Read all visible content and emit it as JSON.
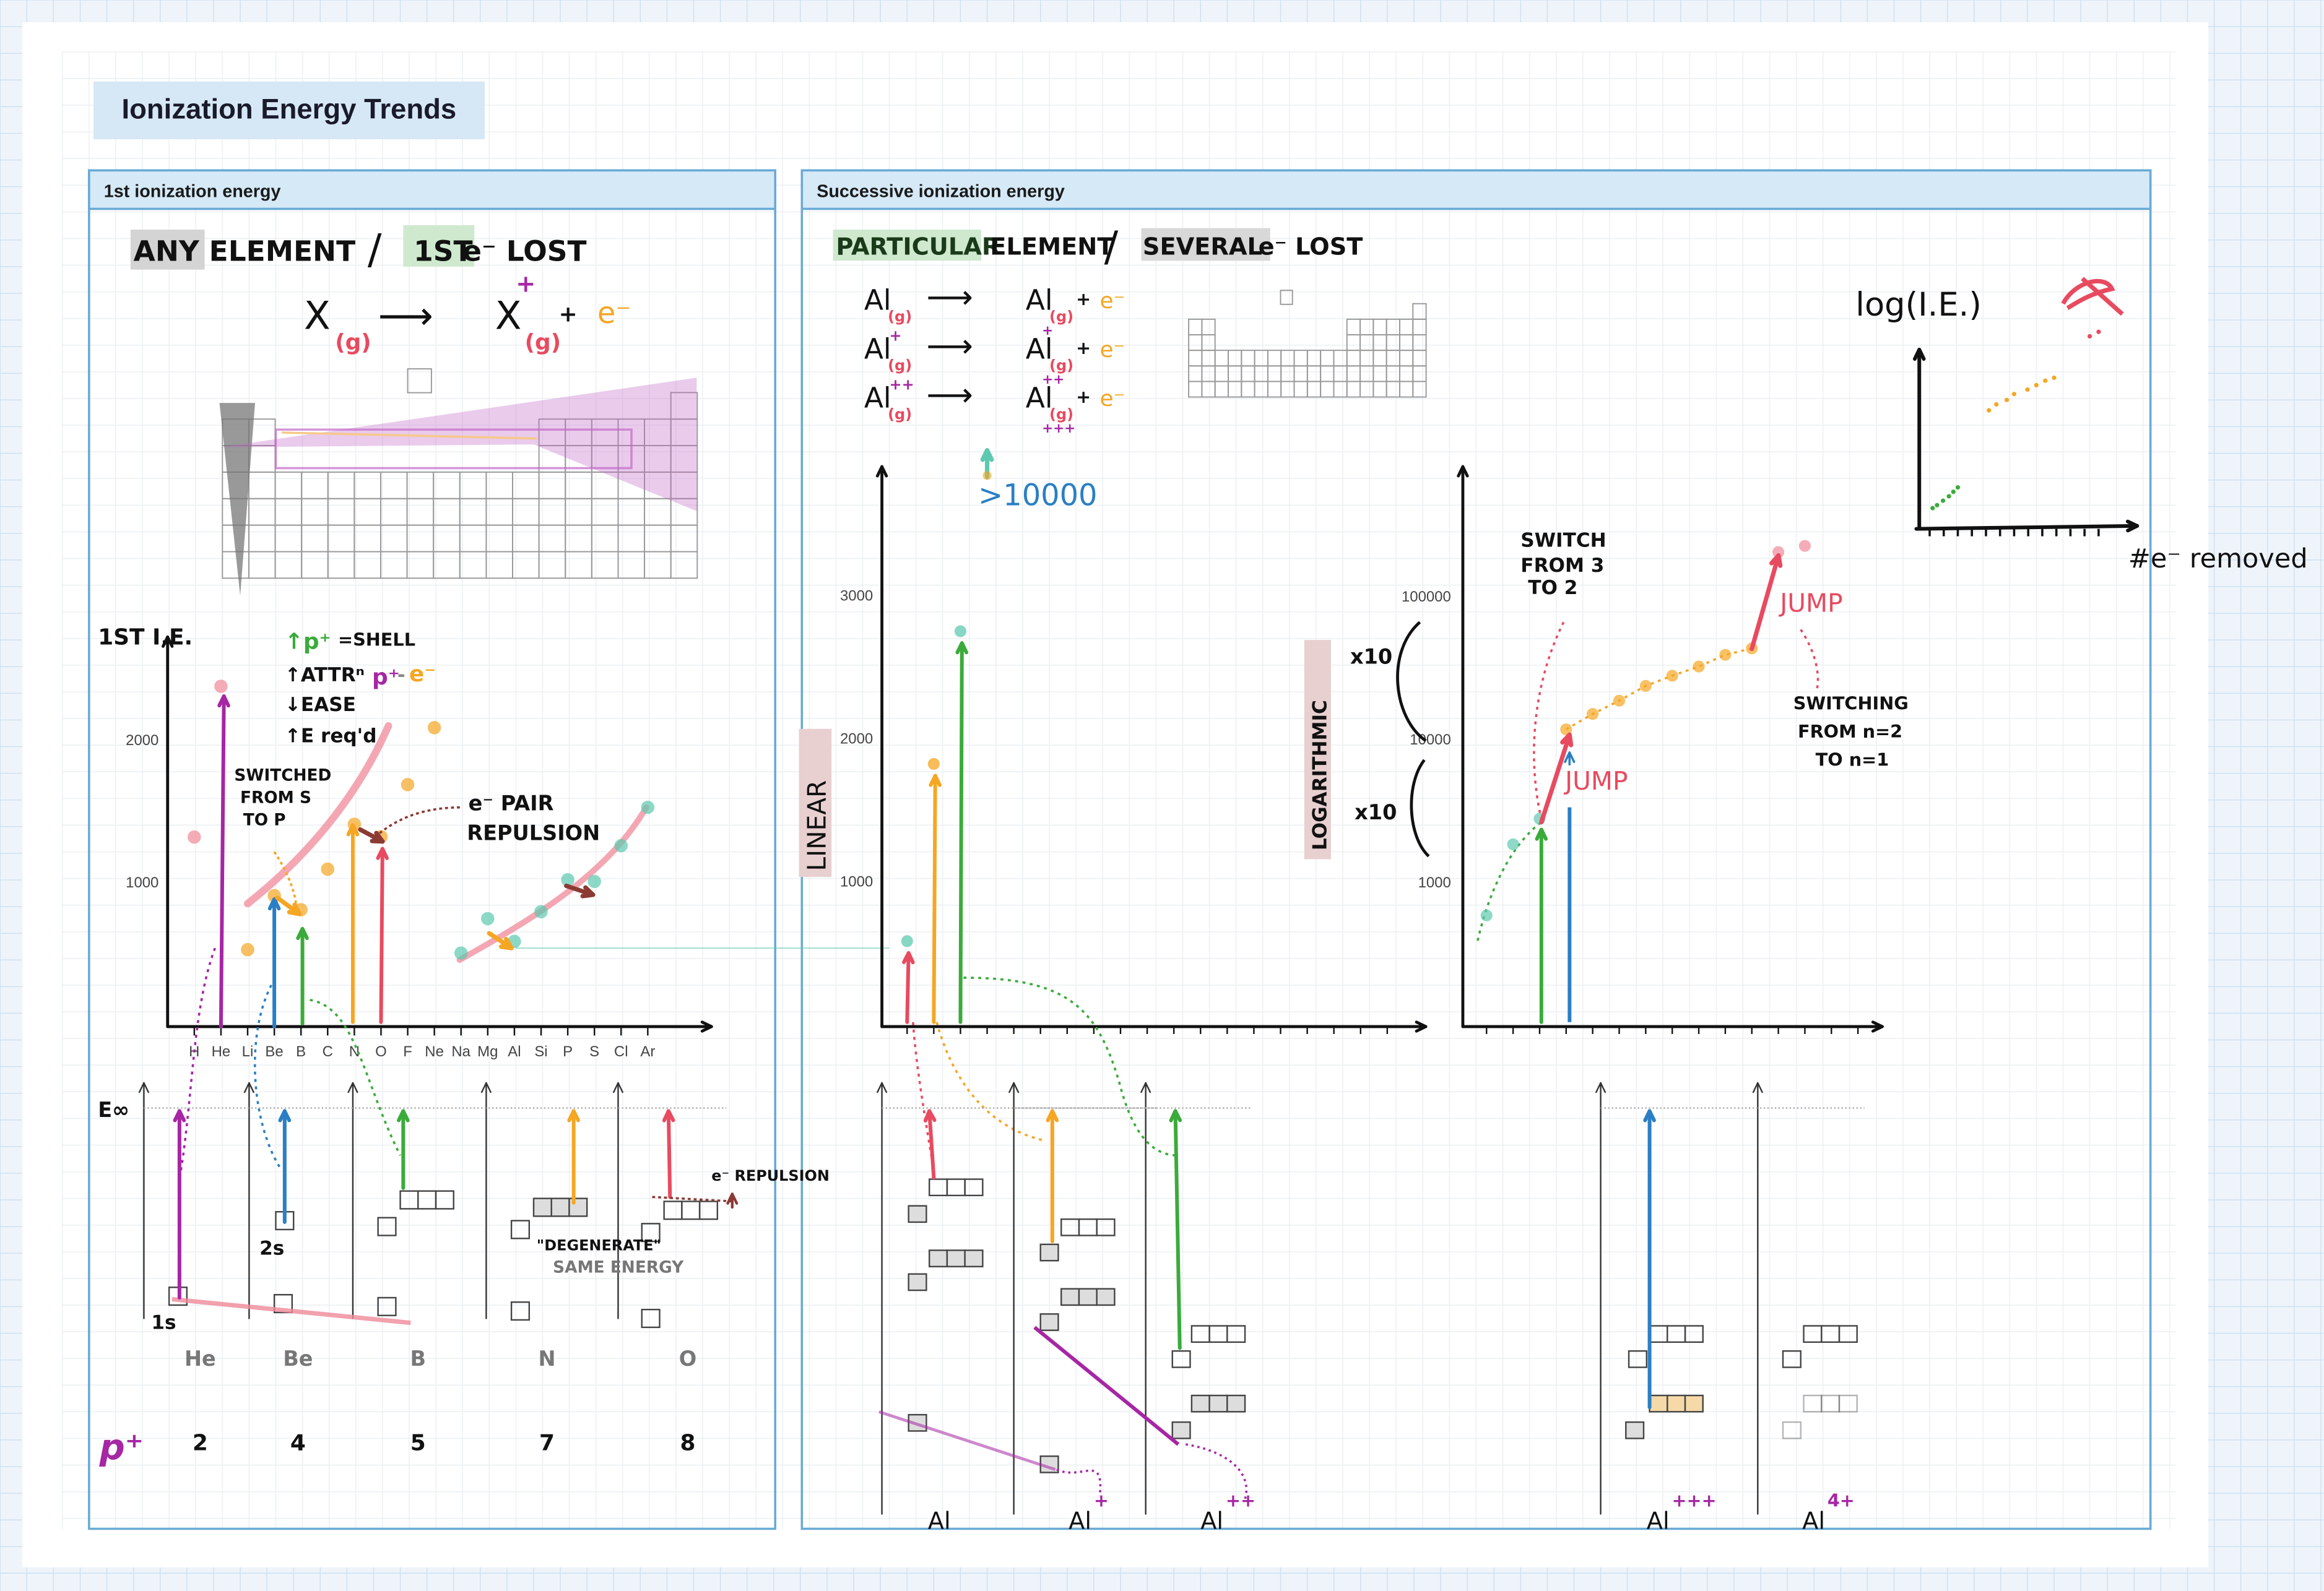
{
  "page": {
    "title": "Ionization Energy Trends"
  },
  "colors": {
    "pink": "#f08a9a",
    "purple": "#a626a4",
    "blue": "#2a7fc4",
    "green": "#3aab3a",
    "orange": "#f5a623",
    "red": "#e84a5f",
    "teal": "#5ec9b0",
    "brown": "#8b3a34",
    "panel_header": "#d5e9f7",
    "panel_border": "#6aaad6"
  },
  "left": {
    "header": "1st ionization energy",
    "heading": {
      "part1": "ANY ELEMENT",
      "sep": "/",
      "part2": "1ST",
      "part3": "e⁻ LOST"
    },
    "equation": {
      "reactant": "X",
      "state": "(g)",
      "arrow": "⟶",
      "product": "X",
      "charge": "+",
      "product_state": "(g)",
      "plus": "+",
      "electron": "e⁻"
    },
    "legend": {
      "l1": "↑p⁺",
      "l1b": "=SHELL",
      "l2": "↑ATTRⁿ",
      "l2b": "p⁺",
      "l2c": "-",
      "l2d": "e⁻",
      "l3": "↓EASE",
      "l4": "↑E req'd"
    },
    "notes": {
      "switched": [
        "SWITCHED",
        "FROM S",
        "TO P"
      ],
      "pair": [
        "e⁻ PAIR",
        "REPULSION"
      ]
    },
    "orbital": {
      "einf": "E∞",
      "s1": "1s",
      "s2": "2s",
      "degenerate": "\"DEGENERATE\"",
      "same": "SAME ENERGY",
      "repulsion": "e⁻ REPULSION",
      "elements": [
        "He",
        "Be",
        "B",
        "N",
        "O"
      ],
      "protons_label": "p⁺",
      "protons": [
        "2",
        "4",
        "5",
        "7",
        "8"
      ]
    }
  },
  "right": {
    "header": "Successive ionization energy",
    "heading": {
      "part1": "PARTICULAR",
      "part2": "ELEMENT",
      "sep": "/",
      "part3": "SEVERAL",
      "part4": "e⁻ LOST"
    },
    "equations": [
      {
        "reactant": "Al",
        "r_charge": "",
        "product": "Al",
        "p_charge": "+",
        "state": "(g)",
        "plus": "+",
        "electron": "e⁻",
        "arrow": "⟶"
      },
      {
        "reactant": "Al",
        "r_charge": "+",
        "product": "Al",
        "p_charge": "++",
        "state": "(g)",
        "plus": "+",
        "electron": "e⁻",
        "arrow": "⟶"
      },
      {
        "reactant": "Al",
        "r_charge": "++",
        "product": "Al",
        "p_charge": "+++",
        "state": "(g)",
        "plus": "+",
        "electron": "e⁻",
        "arrow": "⟶"
      }
    ],
    "offscale": ">10000",
    "linear_label": "LINEAR",
    "log_label": "LOGARITHMIC",
    "x10": [
      "x10",
      "x10"
    ],
    "notes": {
      "switch": [
        "SWITCH",
        "FROM 3",
        "TO 2"
      ],
      "jump1": "JUMP",
      "jump2": "JUMP",
      "switching": [
        "SWITCHING",
        "FROM n=2",
        "TO   n=1"
      ]
    },
    "sketch": {
      "ylabel": "log(I.E.)",
      "xlabel": "#e⁻ removed"
    },
    "ions": [
      {
        "sym": "Al",
        "charge": ""
      },
      {
        "sym": "Al",
        "charge": "+"
      },
      {
        "sym": "Al",
        "charge": "++"
      },
      {
        "sym": "Al",
        "charge": "+++"
      },
      {
        "sym": "Al",
        "charge": "4+"
      }
    ]
  },
  "chart_data": [
    {
      "type": "scatter",
      "title": "1st I.E.",
      "ylabel": "1ST I.E.",
      "xlabel": "",
      "categories": [
        "H",
        "He",
        "Li",
        "Be",
        "B",
        "C",
        "N",
        "O",
        "F",
        "Ne",
        "Na",
        "Mg",
        "Al",
        "Si",
        "P",
        "S",
        "Cl",
        "Ar"
      ],
      "values": [
        1312,
        2372,
        520,
        900,
        801,
        1086,
        1402,
        1314,
        1681,
        2081,
        496,
        738,
        578,
        787,
        1012,
        1000,
        1251,
        1521
      ],
      "series_color": [
        "pink",
        "pink",
        "orange",
        "orange",
        "orange",
        "orange",
        "orange",
        "orange",
        "orange",
        "orange",
        "teal",
        "teal",
        "teal",
        "teal",
        "teal",
        "teal",
        "teal",
        "teal"
      ],
      "yticks": [
        1000,
        2000
      ],
      "ylim": [
        0,
        2600
      ],
      "grid": false
    },
    {
      "type": "scatter",
      "title": "Successive I.E. of Al (linear)",
      "ylabel": "LINEAR",
      "x": [
        1,
        2,
        3
      ],
      "values": [
        577,
        1817,
        2745
      ],
      "colors": [
        "teal",
        "orange",
        "teal"
      ],
      "yticks": [
        1000,
        2000,
        3000
      ],
      "ylim": [
        0,
        3800
      ],
      "grid": false
    },
    {
      "type": "scatter",
      "title": "Successive I.E. of Al (logarithmic)",
      "ylabel": "LOGARITHMIC",
      "yscale": "log",
      "x": [
        1,
        2,
        3,
        4,
        5,
        6,
        7,
        8,
        9,
        10,
        11,
        12,
        13
      ],
      "values": [
        578,
        1817,
        2745,
        11577,
        14842,
        18379,
        23326,
        27465,
        31853,
        38473,
        42647,
        201266,
        222316
      ],
      "groups": [
        "teal",
        "teal",
        "teal",
        "orange",
        "orange",
        "orange",
        "orange",
        "orange",
        "orange",
        "orange",
        "orange",
        "pink",
        "pink"
      ],
      "yticks": [
        1000,
        10000,
        100000
      ],
      "ylim": [
        100,
        1000000
      ],
      "grid": false
    }
  ]
}
